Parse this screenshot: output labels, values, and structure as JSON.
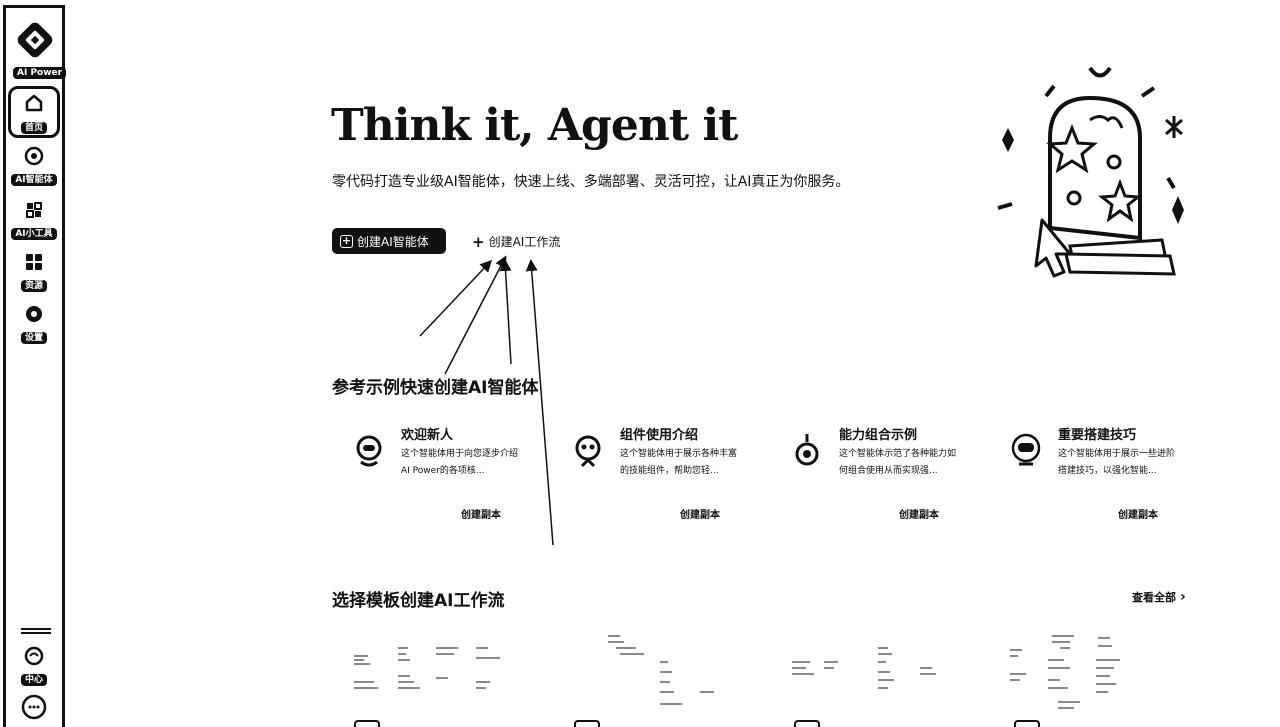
{
  "app": {
    "logo_text": "AI Power"
  },
  "sidebar": {
    "items": [
      {
        "label": "首页",
        "icon": "home-icon"
      },
      {
        "label": "AI智能体",
        "icon": "agent-icon"
      },
      {
        "label": "AI小工具",
        "icon": "tools-icon"
      },
      {
        "label": "资源",
        "icon": "grid-icon"
      },
      {
        "label": "设置",
        "icon": "settings-icon"
      }
    ],
    "bottom": [
      {
        "label": "中心",
        "icon": "community-icon"
      },
      {
        "label": "",
        "icon": "chat-icon"
      }
    ]
  },
  "hero": {
    "title": "Think it, Agent it",
    "subtitle": "零代码打造专业级AI智能体，快速上线、多端部署、灵活可控，让AI真正为你服务。",
    "primary_button": "创建AI智能体",
    "secondary_button": "创建AI工作流"
  },
  "examples": {
    "title": "参考示例快速创建AI智能体",
    "cards": [
      {
        "title": "欢迎新人",
        "desc": "这个智能体用于向您逐步介绍AI Power的各项核...",
        "action": "创建副本"
      },
      {
        "title": "组件使用介绍",
        "desc": "这个智能体用于展示各种丰富的技能组件，帮助您轻...",
        "action": "创建副本"
      },
      {
        "title": "能力组合示例",
        "desc": "这个智能体示范了各种能力如何组合使用从而实现强...",
        "action": "创建副本"
      },
      {
        "title": "重要搭建技巧",
        "desc": "这个智能体用于展示一些进阶搭建技巧，以强化智能...",
        "action": "创建副本"
      }
    ]
  },
  "templates": {
    "title": "选择模板创建AI工作流",
    "view_all": "查看全部"
  }
}
